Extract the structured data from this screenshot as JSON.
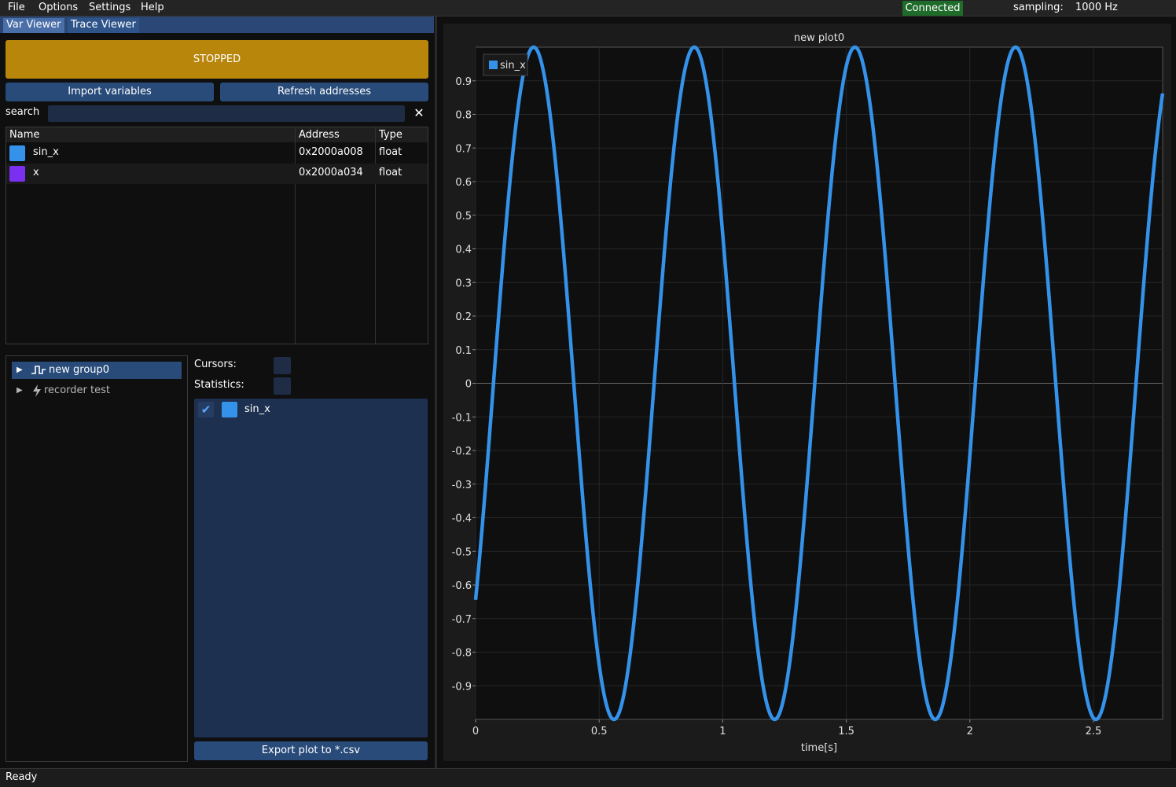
{
  "menu": {
    "file": "File",
    "options": "Options",
    "settings": "Settings",
    "help": "Help"
  },
  "status_badge": "Connected",
  "sampling": {
    "label": "sampling:",
    "value": "1000 Hz"
  },
  "tabs": {
    "var_viewer": "Var Viewer",
    "trace_viewer": "Trace Viewer"
  },
  "run_state": "STOPPED",
  "buttons": {
    "import": "Import variables",
    "refresh": "Refresh addresses",
    "export": "Export plot to *.csv"
  },
  "search": {
    "label": "search",
    "value": "",
    "clear": "✕"
  },
  "var_table": {
    "headers": {
      "name": "Name",
      "address": "Address",
      "type": "Type"
    },
    "rows": [
      {
        "name": "sin_x",
        "address": "0x2000a008",
        "type": "float",
        "color": "#3592ea"
      },
      {
        "name": "x",
        "address": "0x2000a034",
        "type": "float",
        "color": "#7b2ff0"
      }
    ]
  },
  "groups": [
    {
      "label": "new group0",
      "icon": "square-wave-icon"
    },
    {
      "label": "recorder test",
      "icon": "lightning-icon"
    }
  ],
  "options": {
    "cursors": "Cursors:",
    "statistics": "Statistics:"
  },
  "series_list": [
    {
      "name": "sin_x",
      "checked": true,
      "color": "#3592ea",
      "check": "✔"
    }
  ],
  "statusbar": "Ready",
  "chart_data": {
    "type": "scatter",
    "title": "new plot0",
    "xlabel": "time[s]",
    "ylabel": "",
    "xlim": [
      0,
      2.78
    ],
    "ylim": [
      -1,
      1
    ],
    "x_ticks": [
      0,
      0.5,
      1,
      1.5,
      2,
      2.5
    ],
    "x_tick_labels": [
      "0",
      "0.5",
      "1",
      "1.5",
      "2",
      "2.5"
    ],
    "y_ticks": [
      0.9,
      0.8,
      0.7,
      0.6,
      0.5,
      0.4,
      0.3,
      0.2,
      0.1,
      0,
      -0.1,
      -0.2,
      -0.3,
      -0.4,
      -0.5,
      -0.6,
      -0.7,
      -0.8,
      -0.9
    ],
    "y_tick_labels": [
      "0.9",
      "0.8",
      "0.7",
      "0.6",
      "0.5",
      "0.4",
      "0.3",
      "0.2",
      "0.1",
      "0",
      "-0.1",
      "-0.2",
      "-0.3",
      "-0.4",
      "-0.5",
      "-0.6",
      "-0.7",
      "-0.8",
      "-0.9"
    ],
    "grid": true,
    "legend": "top-left",
    "series": [
      {
        "name": "sin_x",
        "color": "#3592ea",
        "function": "sin",
        "period": 0.65,
        "phase_at_zero": -0.7,
        "amplitude": 1.0,
        "sample_step": 0.001
      }
    ]
  }
}
